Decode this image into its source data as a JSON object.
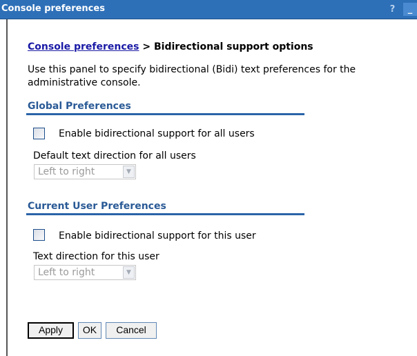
{
  "window": {
    "title": "Console preferences",
    "help_label": "?",
    "minimize_label": "_"
  },
  "breadcrumb": {
    "link": "Console preferences",
    "separator": " > ",
    "current": "Bidirectional support options"
  },
  "intro_text": "Use this panel to specify bidirectional (Bidi) text preferences for the administrative console.",
  "global_prefs": {
    "title": "Global Preferences",
    "checkbox_label": "Enable bidirectional support for all users",
    "checked": false,
    "direction_label": "Default text direction for all users",
    "direction_value": "Left to right"
  },
  "user_prefs": {
    "title": "Current User Preferences",
    "checkbox_label": "Enable bidirectional support for this user",
    "checked": false,
    "direction_label": "Text direction for this user",
    "direction_value": "Left to right"
  },
  "buttons": {
    "apply": "Apply",
    "ok": "OK",
    "cancel": "Cancel"
  },
  "colors": {
    "titlebar": "#2e70b8",
    "section_title": "#2a5a96",
    "link": "#1a1aa6"
  }
}
